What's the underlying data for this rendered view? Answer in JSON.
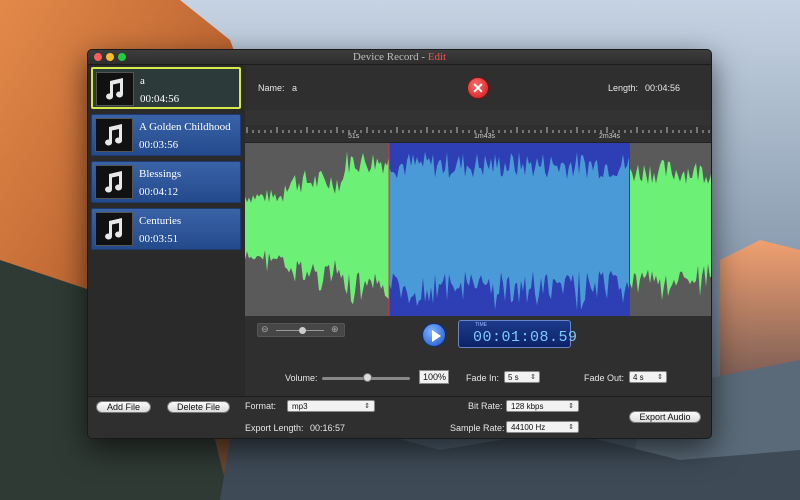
{
  "window": {
    "title": "Device Record -",
    "title_mode": "Edit"
  },
  "tracks": [
    {
      "name": "a",
      "duration": "00:04:56",
      "selected": true
    },
    {
      "name": "A Golden Childhood",
      "duration": "00:03:56",
      "selected": false
    },
    {
      "name": "Blessings",
      "duration": "00:04:12",
      "selected": false
    },
    {
      "name": "Centuries",
      "duration": "00:03:51",
      "selected": false
    }
  ],
  "editor": {
    "name_label": "Name:",
    "name_value": "a",
    "length_label": "Length:",
    "length_value": "00:04:56",
    "ruler_marks": [
      "51s",
      "1m43s",
      "2m34s"
    ],
    "time_caption": "TIME",
    "time_value": "00:01:08.59",
    "volume_label": "Volume:",
    "volume_value": "100%",
    "fade_in_label": "Fade In:",
    "fade_in_value": "5 s",
    "fade_out_label": "Fade Out:",
    "fade_out_value": "4 s"
  },
  "export": {
    "add_file_label": "Add File",
    "delete_file_label": "Delete File",
    "format_label": "Format:",
    "format_value": "mp3",
    "export_length_label": "Export Length:",
    "export_length_value": "00:16:57",
    "bit_rate_label": "Bit Rate:",
    "bit_rate_value": "128 kbps",
    "sample_rate_label": "Sample Rate:",
    "sample_rate_value": "44100 Hz",
    "export_audio_label": "Export Audio"
  },
  "colors": {
    "waveform_unselected": "#6cf075",
    "waveform_selected": "#4a9ad8",
    "selection_background": "#2e3fb5",
    "title_accent": "#ff4a4a"
  }
}
